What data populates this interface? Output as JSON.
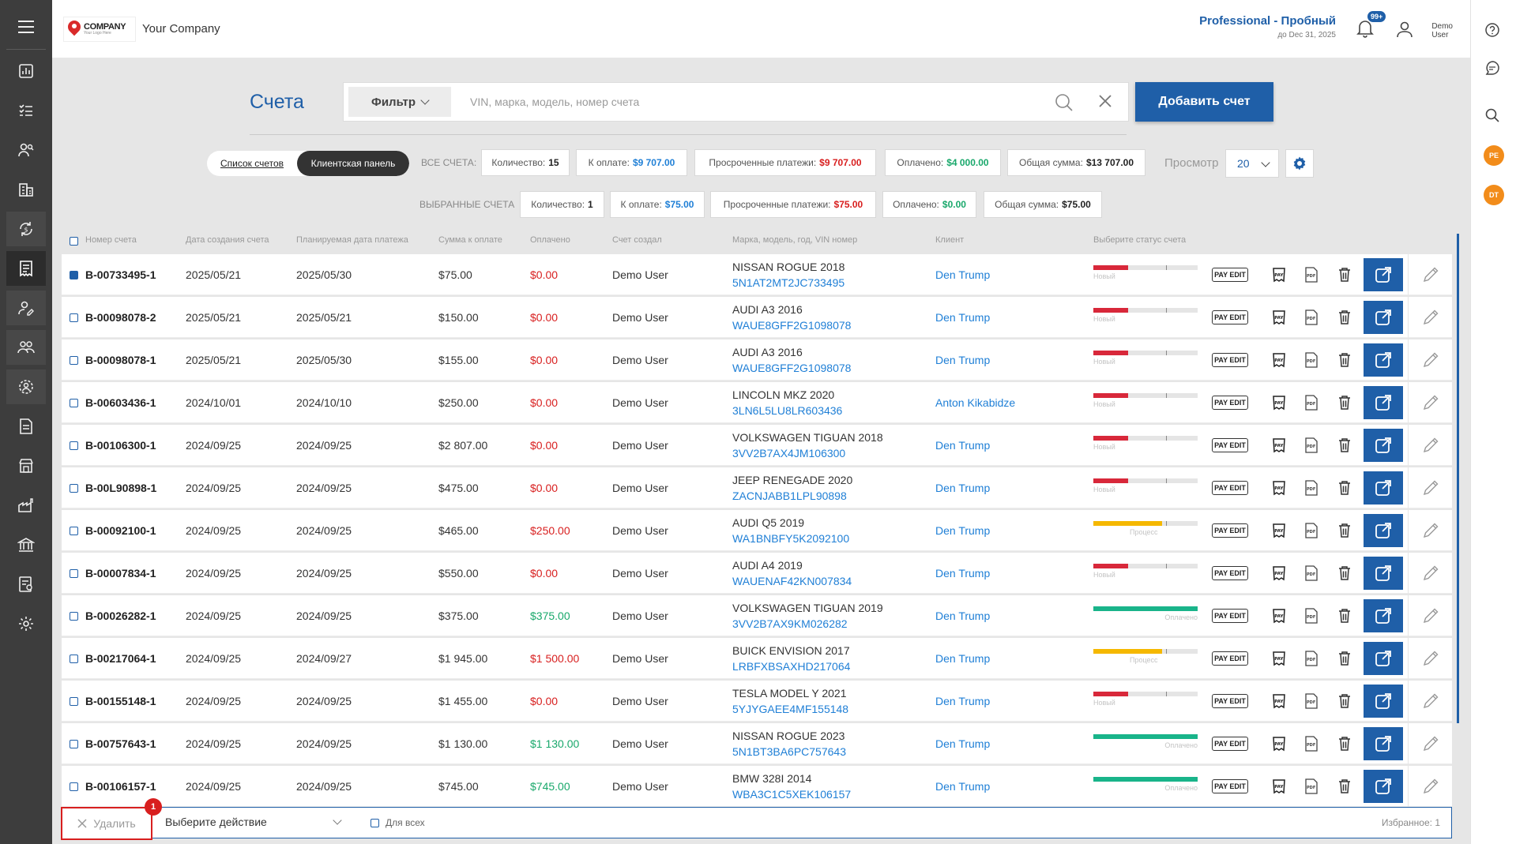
{
  "header": {
    "logo_text": "COMPANY",
    "logo_sub": "Your Logo Here",
    "company_name": "Your Company",
    "plan": "Professional - Пробный",
    "plan_expiry": "до Dec 31, 2025",
    "notifications_badge": "99+",
    "user_line1": "Demo",
    "user_line2": "User"
  },
  "rail": {
    "avatar1": "PE",
    "avatar2": "DT"
  },
  "page": {
    "title": "Счета",
    "filter_label": "Фильтр",
    "search_placeholder": "VIN, марка, модель, номер счета",
    "add_button": "Добавить счет"
  },
  "view_toggle": {
    "list": "Список счетов",
    "panel": "Клиентская панель"
  },
  "all_stats": {
    "label": "ВСЕ СЧЕТА:",
    "count_label": "Количество:",
    "count": "15",
    "due_label": "К оплате:",
    "due": "$9 707.00",
    "overdue_label": "Просроченные платежи:",
    "overdue": "$9 707.00",
    "paid_label": "Оплачено:",
    "paid": "$4 000.00",
    "total_label": "Общая сумма:",
    "total": "$13 707.00"
  },
  "selected_stats": {
    "label": "ВЫБРАННЫЕ СЧЕТА",
    "count_label": "Количество:",
    "count": "1",
    "due_label": "К оплате:",
    "due": "$75.00",
    "overdue_label": "Просроченные платежи:",
    "overdue": "$75.00",
    "paid_label": "Оплачено:",
    "paid": "$0.00",
    "total_label": "Общая сумма:",
    "total": "$75.00"
  },
  "view": {
    "label": "Просмотр",
    "value": "20"
  },
  "table": {
    "columns": [
      "Номер счета",
      "Дата создания счета",
      "Планируемая дата платежа",
      "Сумма к оплате",
      "Оплачено",
      "Счет создал",
      "Марка, модель, год, VIN номер",
      "Клиент",
      "Выберите статус счета"
    ],
    "pay_edit_label": "PAY EDIT",
    "rows": [
      {
        "checked": true,
        "number": "B-00733495-1",
        "created": "2025/05/21",
        "planned": "2025/05/30",
        "amount": "$75.00",
        "paid": "$0.00",
        "paid_state": "red",
        "creator": "Demo User",
        "vehicle": "NISSAN ROGUE 2018",
        "vin": "5N1AT2MT2JC733495",
        "client": "Den Trump",
        "status": "Новый",
        "status_kind": "new",
        "progress": 0.33
      },
      {
        "checked": false,
        "number": "B-00098078-2",
        "created": "2025/05/21",
        "planned": "2025/05/21",
        "amount": "$150.00",
        "paid": "$0.00",
        "paid_state": "red",
        "creator": "Demo User",
        "vehicle": "AUDI A3 2016",
        "vin": "WAUE8GFF2G1098078",
        "client": "Den Trump",
        "status": "Новый",
        "status_kind": "new",
        "progress": 0.33
      },
      {
        "checked": false,
        "number": "B-00098078-1",
        "created": "2025/05/21",
        "planned": "2025/05/30",
        "amount": "$155.00",
        "paid": "$0.00",
        "paid_state": "red",
        "creator": "Demo User",
        "vehicle": "AUDI A3 2016",
        "vin": "WAUE8GFF2G1098078",
        "client": "Den Trump",
        "status": "Новый",
        "status_kind": "new",
        "progress": 0.33
      },
      {
        "checked": false,
        "number": "B-00603436-1",
        "created": "2024/10/01",
        "planned": "2024/10/10",
        "amount": "$250.00",
        "paid": "$0.00",
        "paid_state": "red",
        "creator": "Demo User",
        "vehicle": "LINCOLN MKZ 2020",
        "vin": "3LN6L5LU8LR603436",
        "client": "Anton Kikabidze",
        "status": "Новый",
        "status_kind": "new",
        "progress": 0.33
      },
      {
        "checked": false,
        "number": "B-00106300-1",
        "created": "2024/09/25",
        "planned": "2024/09/25",
        "amount": "$2 807.00",
        "paid": "$0.00",
        "paid_state": "red",
        "creator": "Demo User",
        "vehicle": "VOLKSWAGEN TIGUAN 2018",
        "vin": "3VV2B7AX4JM106300",
        "client": "Den Trump",
        "status": "Новый",
        "status_kind": "new",
        "progress": 0.33
      },
      {
        "checked": false,
        "number": "B-00L90898-1",
        "created": "2024/09/25",
        "planned": "2024/09/25",
        "amount": "$475.00",
        "paid": "$0.00",
        "paid_state": "red",
        "creator": "Demo User",
        "vehicle": "JEEP RENEGADE 2020",
        "vin": "ZACNJABB1LPL90898",
        "client": "Den Trump",
        "status": "Новый",
        "status_kind": "new",
        "progress": 0.33
      },
      {
        "checked": false,
        "number": "B-00092100-1",
        "created": "2024/09/25",
        "planned": "2024/09/25",
        "amount": "$465.00",
        "paid": "$250.00",
        "paid_state": "red",
        "creator": "Demo User",
        "vehicle": "AUDI Q5 2019",
        "vin": "WA1BNBFY5K2092100",
        "client": "Den Trump",
        "status": "Процесс",
        "status_kind": "progress",
        "progress": 0.66
      },
      {
        "checked": false,
        "number": "B-00007834-1",
        "created": "2024/09/25",
        "planned": "2024/09/25",
        "amount": "$550.00",
        "paid": "$0.00",
        "paid_state": "red",
        "creator": "Demo User",
        "vehicle": "AUDI A4 2019",
        "vin": "WAUENAF42KN007834",
        "client": "Den Trump",
        "status": "Новый",
        "status_kind": "new",
        "progress": 0.33
      },
      {
        "checked": false,
        "number": "B-00026282-1",
        "created": "2024/09/25",
        "planned": "2024/09/25",
        "amount": "$375.00",
        "paid": "$375.00",
        "paid_state": "green",
        "creator": "Demo User",
        "vehicle": "VOLKSWAGEN TIGUAN 2019",
        "vin": "3VV2B7AX9KM026282",
        "client": "Den Trump",
        "status": "Оплачено",
        "status_kind": "paid",
        "progress": 1.0
      },
      {
        "checked": false,
        "number": "B-00217064-1",
        "created": "2024/09/25",
        "planned": "2024/09/27",
        "amount": "$1 945.00",
        "paid": "$1 500.00",
        "paid_state": "red",
        "creator": "Demo User",
        "vehicle": "BUICK ENVISION 2017",
        "vin": "LRBFXBSAXHD217064",
        "client": "Den Trump",
        "status": "Процесс",
        "status_kind": "progress",
        "progress": 0.66
      },
      {
        "checked": false,
        "number": "B-00155148-1",
        "created": "2024/09/25",
        "planned": "2024/09/25",
        "amount": "$1 455.00",
        "paid": "$0.00",
        "paid_state": "red",
        "creator": "Demo User",
        "vehicle": "TESLA MODEL Y 2021",
        "vin": "5YJYGAEE4MF155148",
        "client": "Den Trump",
        "status": "Новый",
        "status_kind": "new",
        "progress": 0.33
      },
      {
        "checked": false,
        "number": "B-00757643-1",
        "created": "2024/09/25",
        "planned": "2024/09/25",
        "amount": "$1 130.00",
        "paid": "$1 130.00",
        "paid_state": "green",
        "creator": "Demo User",
        "vehicle": "NISSAN ROGUE 2023",
        "vin": "5N1BT3BA6PC757643",
        "client": "Den Trump",
        "status": "Оплачено",
        "status_kind": "paid",
        "progress": 1.0
      },
      {
        "checked": false,
        "number": "B-00106157-1",
        "created": "2024/09/25",
        "planned": "2024/09/25",
        "amount": "$745.00",
        "paid": "$745.00",
        "paid_state": "green",
        "creator": "Demo User",
        "vehicle": "BMW 328I 2014",
        "vin": "WBA3C1C5XEK106157",
        "client": "Den Trump",
        "status": "Оплачено",
        "status_kind": "paid",
        "progress": 1.0
      }
    ]
  },
  "status_colors": {
    "new": "#d8283a",
    "progress": "#f5b800",
    "paid": "#19b48a"
  },
  "action_bar": {
    "delete_label": "Удалить",
    "delete_badge": "1",
    "action_placeholder": "Выберите действие",
    "for_all_label": "Для всех",
    "favorites": "Избранное: 1"
  }
}
